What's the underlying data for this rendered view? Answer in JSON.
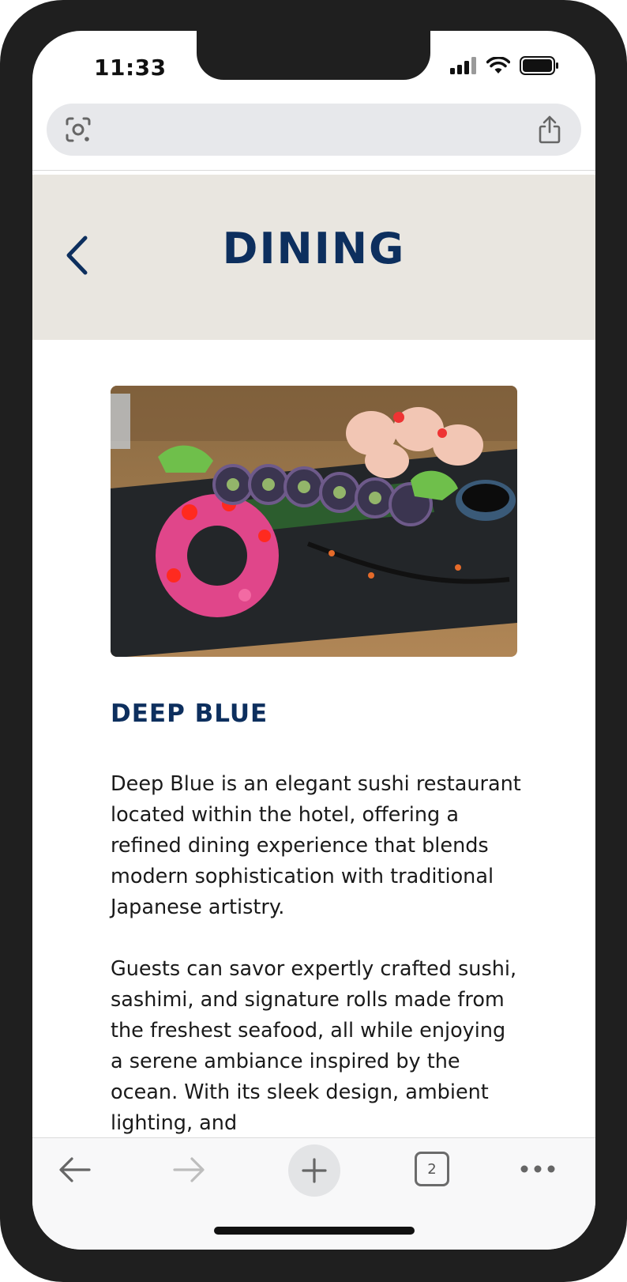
{
  "status_bar": {
    "time": "11:33"
  },
  "browser": {
    "url_text": "",
    "tab_count": "2"
  },
  "header": {
    "title": "DINING"
  },
  "restaurant": {
    "name": "DEEP BLUE",
    "paragraphs": [
      "Deep Blue is an elegant sushi restaurant located within the hotel, offering a refined dining experience that blends modern sophistication with traditional Japanese artistry.",
      "Guests can savor expertly crafted sushi, sashimi, and signature rolls made from the freshest seafood, all while enjoying a serene ambiance inspired by the ocean. With its sleek design, ambient lighting, and"
    ]
  },
  "icons": {
    "back": "chevron-left-icon",
    "lens": "visual-search-icon",
    "share": "share-icon",
    "nav_back": "arrow-left-icon",
    "nav_forward": "arrow-right-icon",
    "new_tab": "plus-icon",
    "more": "more-icon"
  },
  "colors": {
    "brand_navy": "#0d2f5e",
    "header_bg": "#e9e6e0",
    "url_bar_bg": "#e7e8eb"
  }
}
